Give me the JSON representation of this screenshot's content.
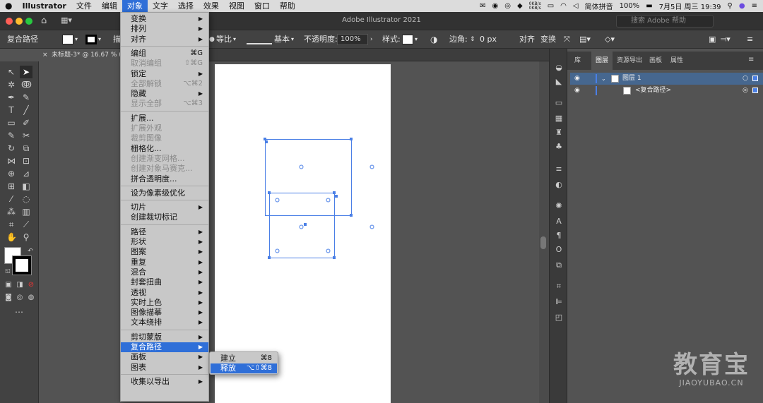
{
  "menubar": {
    "apple": "",
    "app": "Illustrator",
    "items": [
      "文件",
      "编辑",
      "对象",
      "文字",
      "选择",
      "效果",
      "视图",
      "窗口",
      "帮助"
    ],
    "active_index": 2,
    "network_up": "0KB/s",
    "network_down": "0KB/s",
    "input_method": "简体拼音",
    "battery": "100%",
    "datetime": "7月5日 周三  19:39"
  },
  "titlebar": {
    "title": "Adobe Illustrator 2021",
    "search_placeholder": "搜索 Adobe 帮助"
  },
  "controlbar": {
    "selection_label": "复合路径",
    "stroke_prefix": "描",
    "profile_label": "等比",
    "brush_label": "基本",
    "opacity_label": "不透明度:",
    "opacity_value": "100%",
    "style_label": "样式:",
    "corner_label": "边角:",
    "corner_value": "0 px",
    "align_label": "对齐",
    "transform_label": "变换"
  },
  "document": {
    "tab_title": "未标题-3* @ 16.67 % (RG"
  },
  "layers_panel": {
    "tabs": [
      "库",
      "图层",
      "资源导出",
      "画板",
      "属性"
    ],
    "active_tab": 1,
    "layers": [
      {
        "name": "图层 1",
        "selected": true
      },
      {
        "name": "<复合路径>",
        "selected": false
      }
    ]
  },
  "object_menu": {
    "items": [
      {
        "label": "变换",
        "submenu": true
      },
      {
        "label": "排列",
        "submenu": true
      },
      {
        "label": "对齐",
        "submenu": true
      },
      {
        "sep": true
      },
      {
        "label": "编组",
        "shortcut": "⌘G"
      },
      {
        "label": "取消编组",
        "shortcut": "⇧⌘G",
        "disabled": true
      },
      {
        "label": "锁定",
        "submenu": true
      },
      {
        "label": "全部解锁",
        "shortcut": "⌥⌘2",
        "disabled": true
      },
      {
        "label": "隐藏",
        "submenu": true
      },
      {
        "label": "显示全部",
        "shortcut": "⌥⌘3",
        "disabled": true
      },
      {
        "sep": true
      },
      {
        "label": "扩展..."
      },
      {
        "label": "扩展外观",
        "disabled": true
      },
      {
        "label": "裁剪图像",
        "disabled": true
      },
      {
        "label": "栅格化..."
      },
      {
        "label": "创建渐变网格...",
        "disabled": true
      },
      {
        "label": "创建对象马赛克...",
        "disabled": true
      },
      {
        "label": "拼合透明度..."
      },
      {
        "sep": true
      },
      {
        "label": "设为像素级优化"
      },
      {
        "sep": true
      },
      {
        "label": "切片",
        "submenu": true
      },
      {
        "label": "创建裁切标记"
      },
      {
        "sep": true
      },
      {
        "label": "路径",
        "submenu": true
      },
      {
        "label": "形状",
        "submenu": true
      },
      {
        "label": "图案",
        "submenu": true
      },
      {
        "label": "重复",
        "submenu": true
      },
      {
        "label": "混合",
        "submenu": true
      },
      {
        "label": "封套扭曲",
        "submenu": true
      },
      {
        "label": "透视",
        "submenu": true
      },
      {
        "label": "实时上色",
        "submenu": true
      },
      {
        "label": "图像描摹",
        "submenu": true
      },
      {
        "label": "文本绕排",
        "submenu": true
      },
      {
        "sep": true
      },
      {
        "label": "剪切蒙版",
        "submenu": true
      },
      {
        "label": "复合路径",
        "submenu": true,
        "highlight": true
      },
      {
        "label": "画板",
        "submenu": true
      },
      {
        "label": "图表",
        "submenu": true
      },
      {
        "sep": true
      },
      {
        "label": "收集以导出",
        "submenu": true
      }
    ]
  },
  "compound_submenu": {
    "items": [
      {
        "label": "建立",
        "shortcut": "⌘8"
      },
      {
        "label": "释放",
        "shortcut": "⌥⇧⌘8",
        "highlight": true
      }
    ]
  },
  "watermark": {
    "cn": "教育宝",
    "en": "JIAOYUBAO.CN"
  },
  "colors": {
    "accent": "#2f6fd8",
    "selection": "#4a7fe6"
  }
}
